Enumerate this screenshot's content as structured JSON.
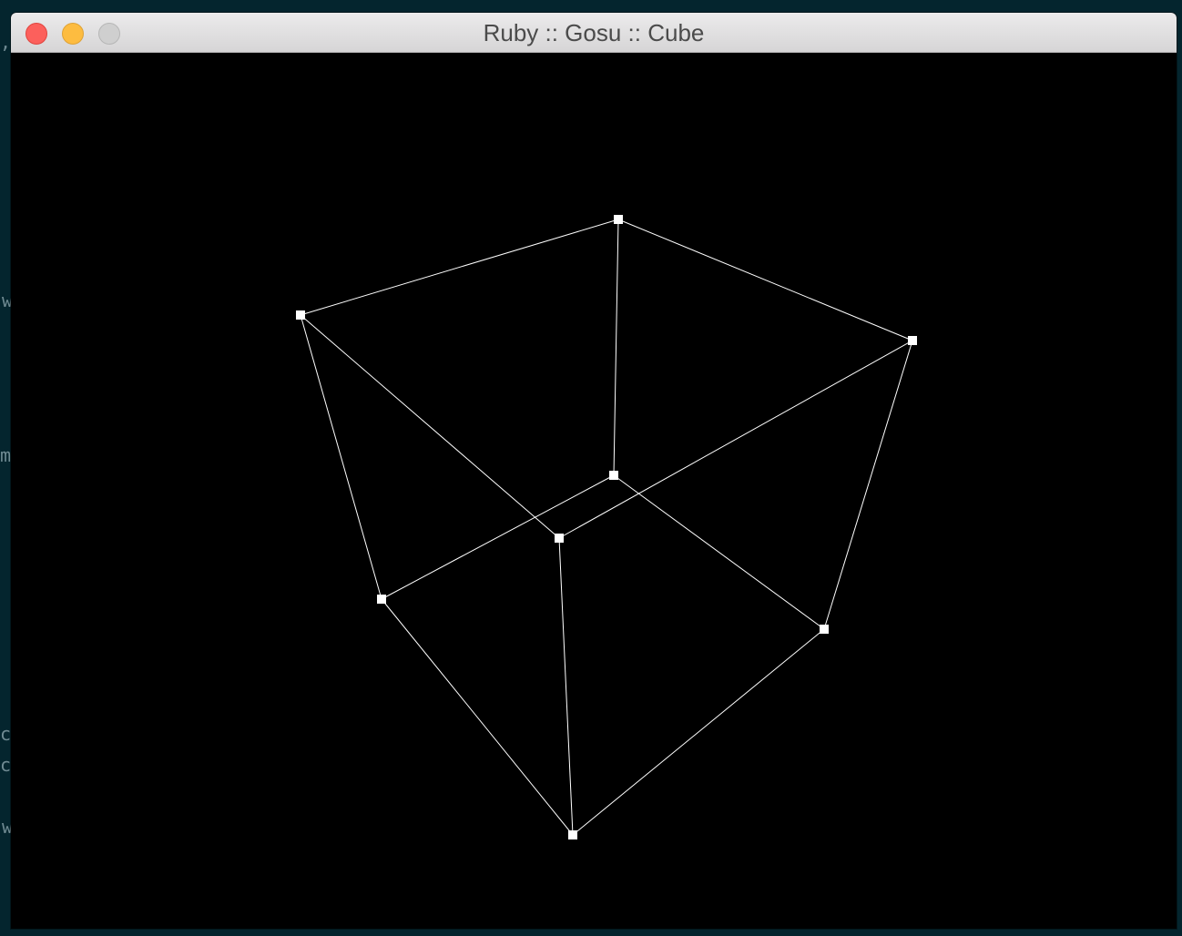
{
  "window": {
    "title": "Ruby :: Gosu :: Cube",
    "buttons": {
      "close": "close-icon",
      "minimize": "minimize-icon",
      "zoom": "zoom-icon"
    }
  },
  "background_fragments": [
    ",",
    "w",
    "m",
    "co",
    "cs",
    "w"
  ],
  "colors": {
    "desktop": "#04252e",
    "canvas": "#000000",
    "wire": "#ffffff",
    "close": "#fc605c",
    "minimize": "#fdbc40",
    "zoom_disabled": "#cfcfcf"
  }
}
